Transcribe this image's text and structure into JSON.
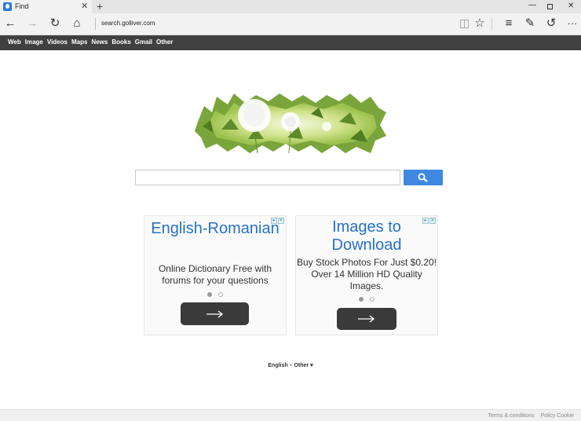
{
  "browser": {
    "tab_title": "Find",
    "address": "search.golliver.com",
    "tab_close": "✕",
    "new_tab": "+",
    "min": "—",
    "close": "✕",
    "back": "←",
    "forward": "→",
    "refresh": "↻",
    "home": "⌂",
    "star": "☆",
    "hub": "≡",
    "note": "✎",
    "share": "↺",
    "more": "···"
  },
  "site_nav": {
    "links": [
      "Web",
      "Image",
      "Videos",
      "Maps",
      "News",
      "Books",
      "Gmail",
      "Other"
    ]
  },
  "search": {
    "value": "",
    "placeholder": ""
  },
  "ads": [
    {
      "title": "English-Romanian",
      "description": "Online Dictionary Free with forums for your questions",
      "active_dot": 0
    },
    {
      "title": "Images to Download",
      "description": "Buy Stock Photos For Just $0.20! Over 14 Million HD Quality Images.",
      "active_dot": 0
    }
  ],
  "language": {
    "current": "English",
    "separator": "–",
    "other": "Other ▾"
  },
  "footer": {
    "terms": "Terms & conditions",
    "policy": "Policy Cookie"
  },
  "colors": {
    "site_bar": "#404040",
    "search_button": "#3f88e2",
    "ad_title": "#2672c8",
    "ad_button": "#3a3a3a"
  }
}
